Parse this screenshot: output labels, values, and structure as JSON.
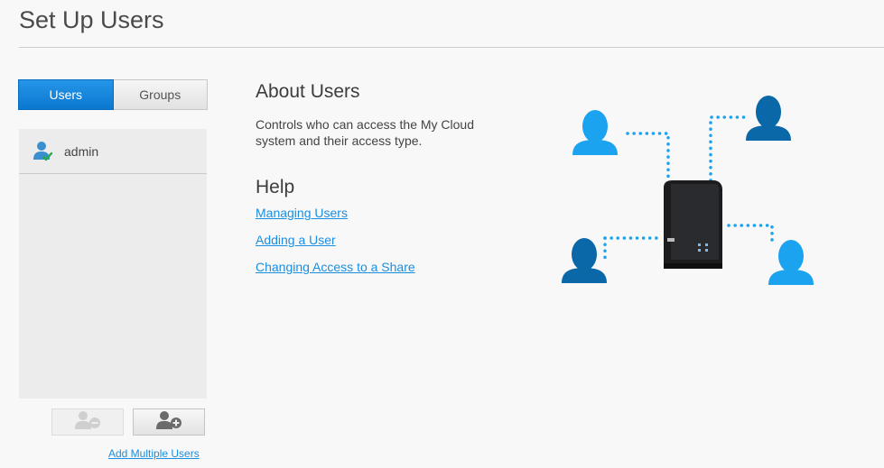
{
  "page": {
    "title": "Set Up Users"
  },
  "tabs": {
    "users": "Users",
    "groups": "Groups"
  },
  "user_list": [
    {
      "name": "admin"
    }
  ],
  "buttons": {
    "add_multiple_users": "Add Multiple Users"
  },
  "about": {
    "title": "About Users",
    "text": "Controls who can access the My Cloud system and their access type."
  },
  "help": {
    "title": "Help",
    "links": [
      "Managing Users",
      "Adding a User",
      "Changing Access to a Share"
    ]
  },
  "colors": {
    "accent": "#0b78d0",
    "link": "#1a8ee0",
    "person_light": "#1ba3ef",
    "person_dark": "#0a68a8"
  },
  "icons": {
    "user_row": "user-check-icon",
    "remove_user": "user-remove-icon",
    "add_user": "user-add-icon"
  }
}
